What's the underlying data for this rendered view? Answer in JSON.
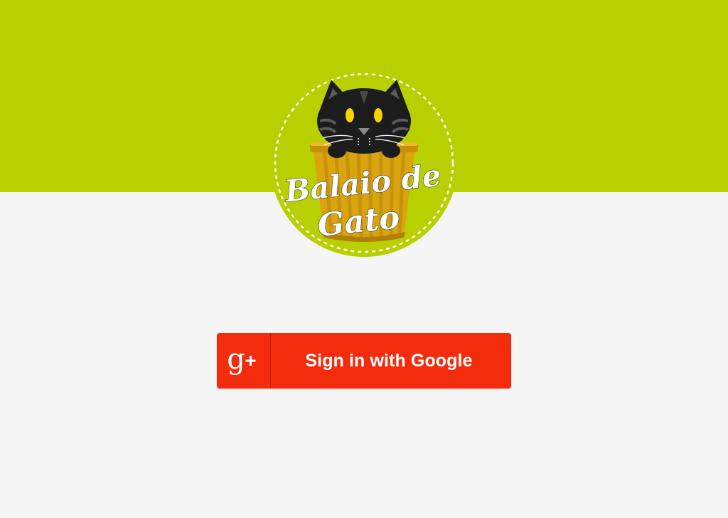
{
  "brand": {
    "logo_line1": "Balaio de",
    "logo_line2": "Gato"
  },
  "signin": {
    "label": "Sign in with Google",
    "icon": "google-plus-icon"
  },
  "colors": {
    "top_band": "#b8cf00",
    "background": "#f5f5f5",
    "button": "#f22c0c",
    "button_text": "#ffffff",
    "basket": "#d7a20c",
    "cat": "#1c1c1c",
    "cat_eyes": "#f5d400"
  }
}
